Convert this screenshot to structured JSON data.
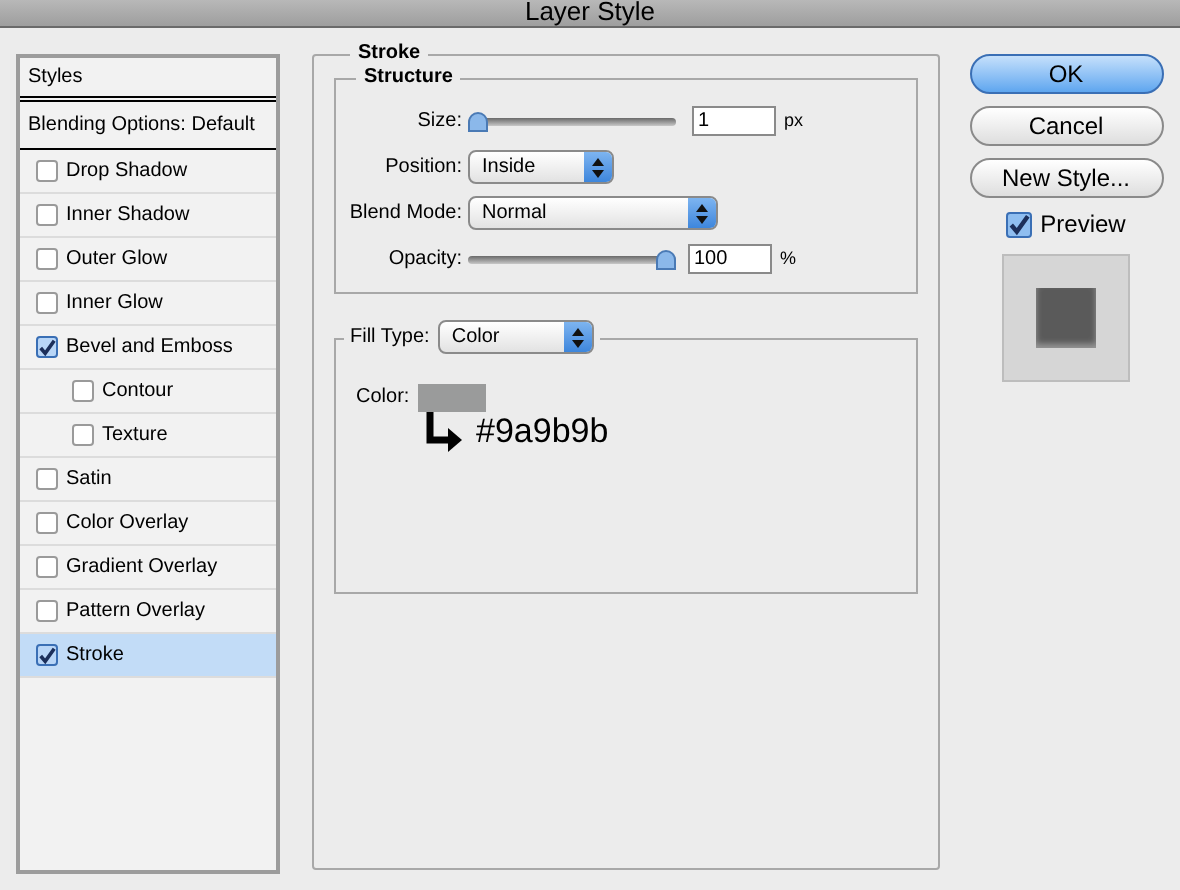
{
  "window": {
    "title": "Layer Style"
  },
  "sidebar": {
    "header": "Styles",
    "blending": "Blending Options: Default",
    "items": [
      {
        "label": "Drop Shadow",
        "checked": false,
        "selected": false
      },
      {
        "label": "Inner Shadow",
        "checked": false,
        "selected": false
      },
      {
        "label": "Outer Glow",
        "checked": false,
        "selected": false
      },
      {
        "label": "Inner Glow",
        "checked": false,
        "selected": false
      },
      {
        "label": "Bevel and Emboss",
        "checked": true,
        "selected": false,
        "children": [
          {
            "label": "Contour",
            "checked": false,
            "selected": false
          },
          {
            "label": "Texture",
            "checked": false,
            "selected": false
          }
        ]
      },
      {
        "label": "Satin",
        "checked": false,
        "selected": false
      },
      {
        "label": "Color Overlay",
        "checked": false,
        "selected": false
      },
      {
        "label": "Gradient Overlay",
        "checked": false,
        "selected": false
      },
      {
        "label": "Pattern Overlay",
        "checked": false,
        "selected": false
      },
      {
        "label": "Stroke",
        "checked": true,
        "selected": true
      }
    ]
  },
  "stroke": {
    "title": "Stroke",
    "structure": {
      "title": "Structure",
      "size": {
        "label": "Size:",
        "level": 0,
        "value": "1",
        "unit": "px"
      },
      "position": {
        "label": "Position:",
        "value": "Inside"
      },
      "blend_mode": {
        "label": "Blend Mode:",
        "value": "Normal"
      },
      "opacity": {
        "label": "Opacity:",
        "level": 1,
        "value": "100",
        "unit": "%"
      }
    },
    "fill_type": {
      "label": "Fill Type:",
      "value": "Color"
    },
    "color": {
      "label": "Color:",
      "color": "#9a9b9b",
      "annotation": "#9a9b9b"
    }
  },
  "buttons": [
    {
      "label": "OK",
      "default": true
    },
    {
      "label": "Cancel",
      "default": false
    },
    {
      "label": "New Style...",
      "default": false
    }
  ],
  "preview": {
    "label": "Preview",
    "checked": true
  }
}
